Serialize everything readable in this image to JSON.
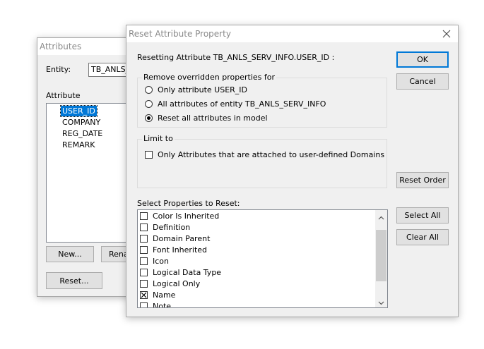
{
  "attributes_window": {
    "title": "Attributes",
    "entity_label": "Entity:",
    "entity_value": "TB_ANLS_",
    "attribute_label": "Attribute",
    "attributes": [
      "USER_ID",
      "COMPANY",
      "REG_DATE",
      "REMARK"
    ],
    "selected_index": 0,
    "new_button": "New...",
    "rename_button": "Rena",
    "reset_button": "Reset..."
  },
  "dialog": {
    "title": "Reset Attribute Property",
    "close_icon": "close-icon",
    "heading": "Resetting Attribute TB_ANLS_SERV_INFO.USER_ID :",
    "ok_button": "OK",
    "cancel_button": "Cancel",
    "reset_order_button": "Reset Order",
    "select_all_button": "Select All",
    "clear_all_button": "Clear All",
    "remove_group": {
      "label": "Remove overridden properties for",
      "options": [
        {
          "label": "Only attribute USER_ID",
          "selected": false
        },
        {
          "label": "All attributes of entity TB_ANLS_SERV_INFO",
          "selected": false
        },
        {
          "label": "Reset all attributes in model",
          "selected": true
        }
      ]
    },
    "limit_group": {
      "label": "Limit to",
      "checkbox_label": "Only Attributes that are attached to user-defined Domains",
      "checked": false
    },
    "properties_label": "Select Properties to Reset:",
    "properties": [
      {
        "label": "Color Is Inherited",
        "checked": false
      },
      {
        "label": "Definition",
        "checked": false
      },
      {
        "label": "Domain Parent",
        "checked": false
      },
      {
        "label": "Font Inherited",
        "checked": false
      },
      {
        "label": "Icon",
        "checked": false
      },
      {
        "label": "Logical Data Type",
        "checked": false
      },
      {
        "label": "Logical Only",
        "checked": false
      },
      {
        "label": "Name",
        "checked": true
      },
      {
        "label": "Note",
        "checked": false
      }
    ]
  }
}
